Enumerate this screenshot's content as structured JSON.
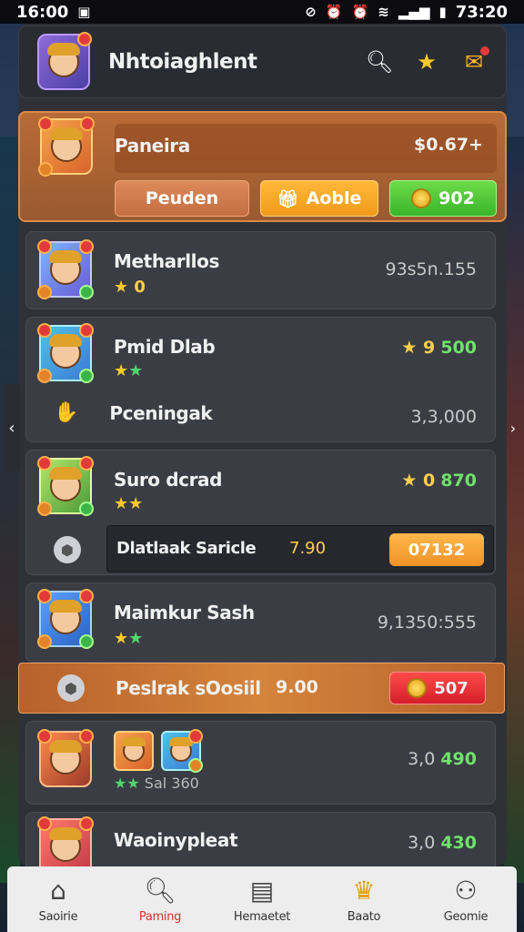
{
  "status": {
    "left_time": "16:00",
    "right_time": "73:20"
  },
  "header": {
    "title": "Nhtoiaghlent"
  },
  "featured": {
    "name": "Paneira",
    "value": "$0.67+",
    "btn_1": "Peuden",
    "btn_2": "Aoble",
    "btn_3": "902"
  },
  "rows": [
    {
      "name": "Metharllos",
      "stars_text": "0",
      "value": "93s5n.155"
    },
    {
      "name": "Pmid Dlab",
      "value_prefix": "★ 9",
      "value": "500",
      "sub_label": "Pceningak",
      "sub_value": "3,3,000"
    },
    {
      "name": "Suro dcrad",
      "value_prefix": "★ 0",
      "value": "870",
      "sub_label": "Dlatlaak Saricle",
      "sub_mid": "7.90",
      "sub_btn": "07132"
    },
    {
      "name": "Maimkur Sash",
      "value": "9,1350:555",
      "sub_label": "Peslrak sOosiil",
      "sub_mid": "9.00",
      "sub_btn": "507"
    },
    {
      "name": "",
      "small_text": "Sal 360",
      "value_prefix": "3,0",
      "value": "490"
    },
    {
      "name": "Waoinypleat",
      "value_prefix": "3,0",
      "value": "430"
    }
  ],
  "nav": [
    {
      "label": "Saoirie"
    },
    {
      "label": "Paming"
    },
    {
      "label": "Hemaetet"
    },
    {
      "label": "Baato"
    },
    {
      "label": "Geomie"
    }
  ],
  "colors": {
    "accent_orange": "#d5843c",
    "accent_green": "#3ab42a",
    "accent_red": "#d41f2a",
    "active_nav": "#d8322a"
  }
}
